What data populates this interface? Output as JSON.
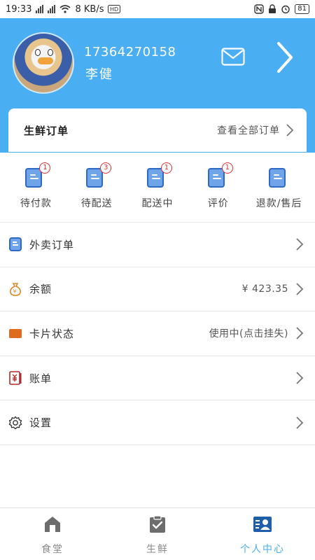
{
  "status_bar": {
    "time": "19:33",
    "network_speed": "8 KB/s",
    "battery": "81"
  },
  "profile": {
    "phone": "17364270158",
    "name": "李健"
  },
  "order_card": {
    "title": "生鲜订单",
    "view_all": "查看全部订单"
  },
  "order_statuses": [
    {
      "label": "待付款",
      "badge": "1"
    },
    {
      "label": "待配送",
      "badge": "3"
    },
    {
      "label": "配送中",
      "badge": "1"
    },
    {
      "label": "评价",
      "badge": "1"
    },
    {
      "label": "退款/售后",
      "badge": ""
    }
  ],
  "menu": [
    {
      "label": "外卖订单",
      "value": "",
      "icon": "document-icon"
    },
    {
      "label": "余额",
      "value": "¥ 423.35",
      "icon": "money-bag-icon"
    },
    {
      "label": "卡片状态",
      "value": "使用中(点击挂失)",
      "icon": "card-icon"
    },
    {
      "label": "账单",
      "value": "",
      "icon": "bill-icon"
    },
    {
      "label": "设置",
      "value": "",
      "icon": "gear-icon"
    }
  ],
  "bottom_nav": {
    "tabs": [
      {
        "label": "食堂",
        "icon": "home-icon"
      },
      {
        "label": "生鲜",
        "icon": "clipboard-check-icon"
      },
      {
        "label": "个人中心",
        "icon": "profile-card-icon"
      }
    ],
    "active_index": 2
  },
  "colors": {
    "primary": "#4aaef3",
    "doc_icon": "#2e69c4",
    "badge": "#e03030"
  }
}
